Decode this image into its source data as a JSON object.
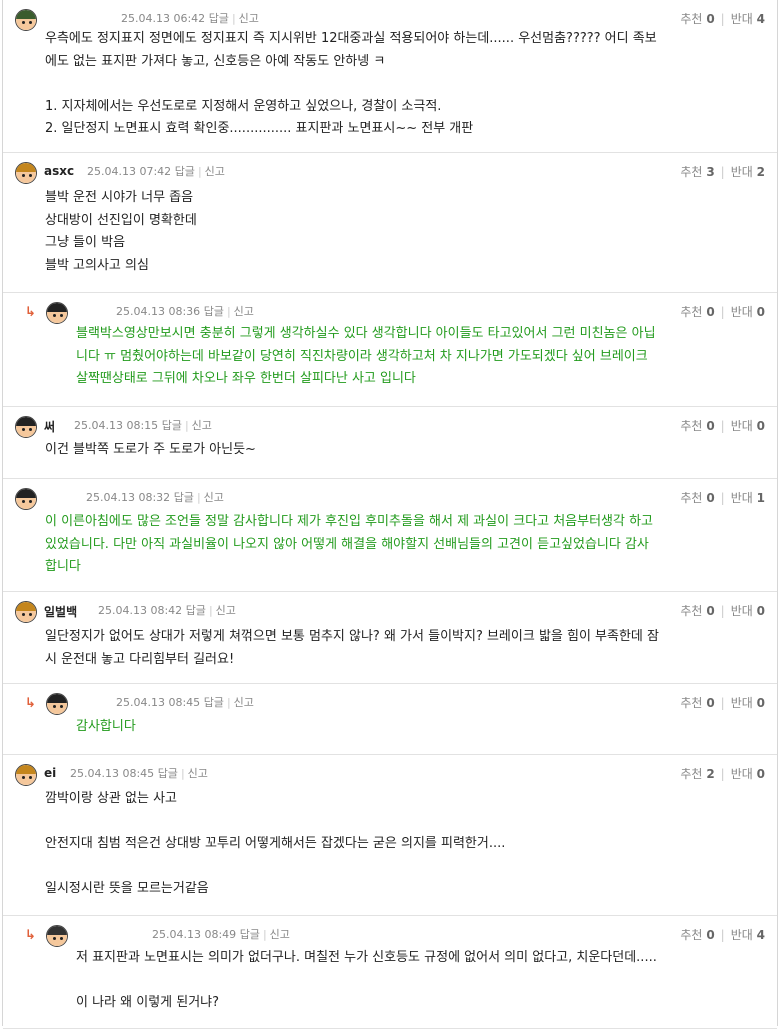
{
  "labels": {
    "reply": "답글",
    "report": "신고",
    "recommend": "추천",
    "oppose": "반대"
  },
  "comments": [
    {
      "nick": "",
      "date": "25.04.13 06:42",
      "up": "0",
      "down": "4",
      "lines": [
        "우측에도 정지표지 정면에도 정지표지 즉 지시위반 12대중과실 적용되어야 하는데...... 우선멈춤????? 어디 족보",
        "에도 없는 표지판 가져다 놓고, 신호등은 아예 작동도 안하넹 ㅋ",
        "",
        "1. 지자체에서는 우선도로로 지정해서 운영하고 싶었으나, 경찰이 소극적.",
        "2. 일단정지 노면표시 효력 확인중............... 표지판과 노면표시~~ 전부 개판"
      ]
    },
    {
      "nick": "asxc",
      "date": "25.04.13 07:42",
      "up": "3",
      "down": "2",
      "lines": [
        "블박 운전 시야가 너무 좁음",
        "상대방이 선진입이 명확한데",
        "그냥 들이 박음",
        "블박 고의사고 의심"
      ]
    },
    {
      "nick": "",
      "date": "25.04.13 08:36",
      "up": "0",
      "down": "0",
      "lines": [
        "블랙박스영상만보시면 충분히 그렇게 생각하실수 있다 생각합니다 아이들도 타고있어서 그런 미친놈은 아닙",
        "니다 ㅠ 멈췄어야하는데 바보같이 당연히 직진차량이라 생각하고처 차 지나가면 가도되겠다 싶어 브레이크",
        "살짝땐상태로 그뒤에 차오나 좌우 한번더 살피다난 사고 입니다"
      ]
    },
    {
      "nick": "써",
      "date": "25.04.13 08:15",
      "up": "0",
      "down": "0",
      "lines": [
        "이건 블박쪽 도로가 주 도로가 아닌듯~"
      ]
    },
    {
      "nick": "",
      "date": "25.04.13 08:32",
      "up": "0",
      "down": "1",
      "lines": [
        "이 이른아침에도 많은 조언들 정말 감사합니다 제가 후진입 후미추돌을 해서 제 과실이 크다고 처음부터생각 하고",
        "있었습니다. 다만 아직 과실비율이 나오지 않아 어떻게 해결을 해야할지 선배님들의 고견이 듣고싶었습니다 감사",
        "합니다"
      ]
    },
    {
      "nick": "일벌백",
      "date": "25.04.13 08:42",
      "up": "0",
      "down": "0",
      "lines": [
        "일단정지가 없어도 상대가 저렇게 쳐꺾으면 보통 멈추지 않나? 왜 가서 들이박지? 브레이크 밟을 힘이 부족한데 잠",
        "시 운전대 놓고 다리힘부터 길러요!"
      ]
    },
    {
      "nick": "",
      "date": "25.04.13 08:45",
      "up": "0",
      "down": "0",
      "lines": [
        "감사합니다"
      ]
    },
    {
      "nick": "ei",
      "date": "25.04.13 08:45",
      "up": "2",
      "down": "0",
      "lines": [
        "깜박이랑 상관 없는 사고",
        "",
        "안전지대 침범 적은건 상대방 꼬투리 어떻게해서든 잡겠다는 굳은 의지를 피력한거....",
        "",
        "일시정시란 뜻을 모르는거같음"
      ]
    },
    {
      "nick": "",
      "date": "25.04.13 08:49",
      "up": "0",
      "down": "4",
      "lines": [
        "저 표지판과 노면표시는 의미가 없더구나. 며칠전 누가 신호등도 규정에 없어서 의미 없다고, 치운다던데.....",
        "",
        "이 나라 왜 이렇게 된거냐?"
      ]
    }
  ],
  "colors": {
    "accent_reply": "#239b1d",
    "arrow": "#e0603a"
  },
  "icons": {
    "reply_arrow": "reply-arrow-icon",
    "avatar": "avatar-icon"
  }
}
